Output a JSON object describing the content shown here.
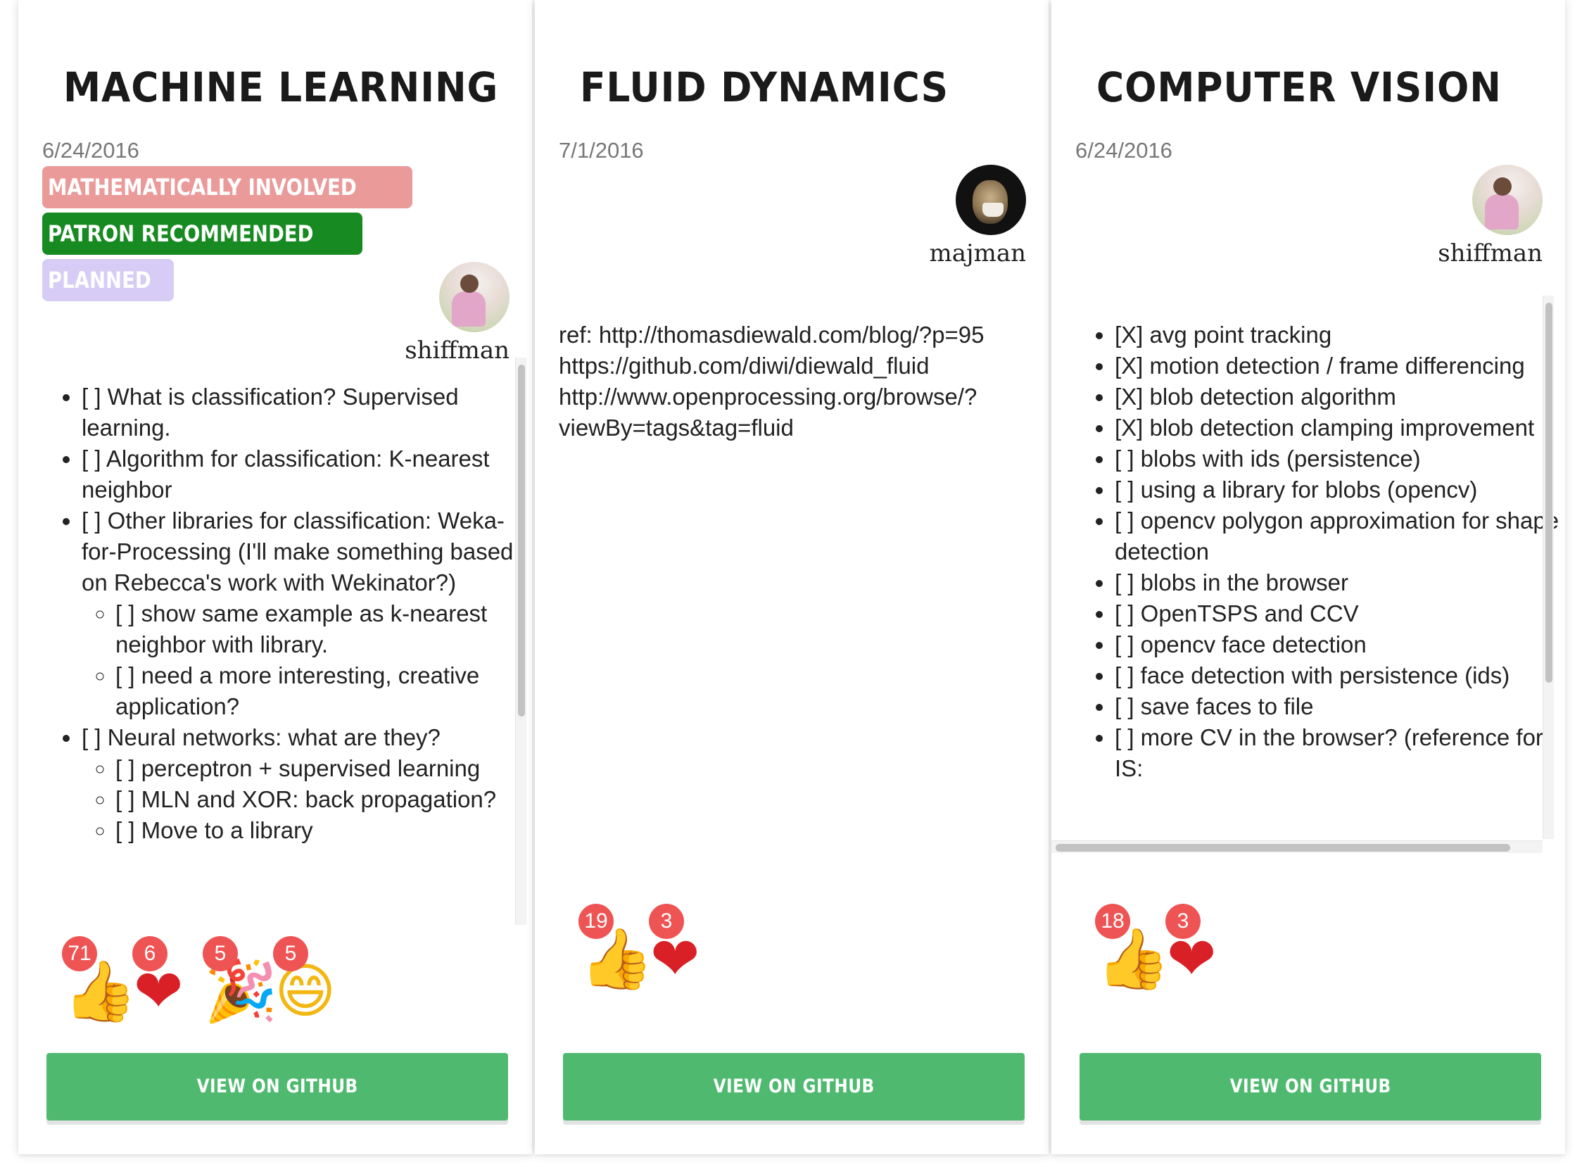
{
  "colors": {
    "label_mathematically_involved": "#eb9a9a",
    "label_patron_recommended": "#178b21",
    "label_planned": "#d6ccf6",
    "github_button": "#4fba6f",
    "reaction_badge": "#ef5454"
  },
  "cards": [
    {
      "title": "MACHINE LEARNING",
      "date": "6/24/2016",
      "labels": [
        "MATHEMATICALLY INVOLVED",
        "PATRON RECOMMENDED",
        "PLANNED"
      ],
      "author": {
        "name": "shiffman",
        "avatar": "avatar-shiffman"
      },
      "tasks": [
        "[ ] What is classification? Supervised learning.",
        "[ ] Algorithm for classification: K-nearest neighbor",
        "[ ] Other libraries for classification: Weka-for-Processing (I'll make something based on Rebecca's work with Wekinator?)",
        "[ ] show same example as k-nearest neighbor with library.",
        "[ ] need a more interesting, creative application?",
        "[ ] Neural networks: what are they?",
        "[ ] perceptron + supervised learning",
        "[ ] MLN and XOR: back propagation?",
        "[ ] Move to a library"
      ],
      "reactions": [
        {
          "icon": "thumbs-up-icon",
          "glyph": "👍",
          "count": "71"
        },
        {
          "icon": "heart-icon",
          "glyph": "❤",
          "count": "6"
        },
        {
          "icon": "party-popper-icon",
          "glyph": "🎉",
          "count": "5"
        },
        {
          "icon": "smile-icon",
          "glyph": "😄",
          "count": "5"
        }
      ],
      "button": "VIEW ON GITHUB"
    },
    {
      "title": "FLUID DYNAMICS",
      "date": "7/1/2016",
      "labels": [],
      "author": {
        "name": "majman",
        "avatar": "avatar-majman"
      },
      "body_lines": [
        "ref: http://thomasdiewald.com/blog/?p=95",
        "https://github.com/diwi/diewald_fluid",
        "http://www.openprocessing.org/browse/?",
        "viewBy=tags&tag=fluid"
      ],
      "reactions": [
        {
          "icon": "thumbs-up-icon",
          "glyph": "👍",
          "count": "19"
        },
        {
          "icon": "heart-icon",
          "glyph": "❤",
          "count": "3"
        }
      ],
      "button": "VIEW ON GITHUB"
    },
    {
      "title": "COMPUTER VISION",
      "date": "6/24/2016",
      "labels": [],
      "author": {
        "name": "shiffman",
        "avatar": "avatar-shiffman"
      },
      "tasks": [
        "[X] avg point tracking",
        "[X] motion detection / frame differencing",
        "[X] blob detection algorithm",
        "[X] blob detection clamping improvement",
        "[ ] blobs with ids (persistence)",
        "[ ] using a library for blobs (opencv)",
        "[ ] opencv polygon approximation for shape detection",
        "[ ] blobs in the browser",
        "[ ] OpenTSPS and CCV",
        "[ ] opencv face detection",
        "[ ] face detection with persistence (ids)",
        "[ ] save faces to file",
        "[ ] more CV in the browser? (reference for IS:"
      ],
      "reactions": [
        {
          "icon": "thumbs-up-icon",
          "glyph": "👍",
          "count": "18"
        },
        {
          "icon": "heart-icon",
          "glyph": "❤",
          "count": "3"
        }
      ],
      "button": "VIEW ON GITHUB"
    }
  ]
}
